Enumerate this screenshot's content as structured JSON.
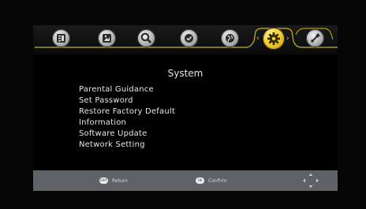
{
  "screen": {
    "title": "System",
    "menu_items": [
      {
        "label": "Parental Guidance"
      },
      {
        "label": "Set Password"
      },
      {
        "label": "Restore Factory Default"
      },
      {
        "label": "Information"
      },
      {
        "label": "Software Update"
      },
      {
        "label": "Network Setting"
      }
    ]
  },
  "tabs": [
    {
      "icon": "program-guide-icon"
    },
    {
      "icon": "picture-icon"
    },
    {
      "icon": "search-icon"
    },
    {
      "icon": "timer-icon"
    },
    {
      "icon": "globe-icon"
    },
    {
      "icon": "gear-icon",
      "selected": true
    },
    {
      "icon": "usb-icon"
    }
  ],
  "bottom_bar": {
    "return_key": "EXIT",
    "return_label": "Return",
    "confirm_key": "OK",
    "confirm_label": "Confirm"
  },
  "colors": {
    "accent": "#f4cf2d",
    "tab_line": "#c9b21f",
    "bar": "#5f6368",
    "text": "#e6e6e6"
  }
}
